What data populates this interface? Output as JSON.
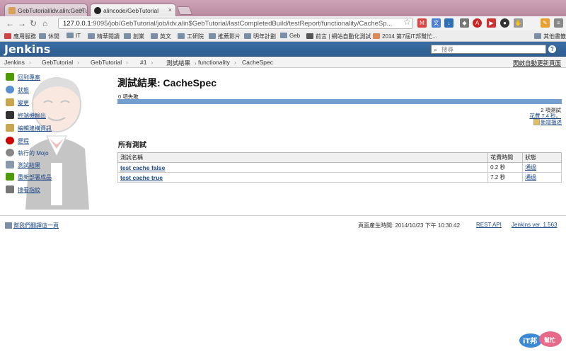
{
  "browser": {
    "tabs": [
      {
        "label": "GebTutorial/idv.alin:GebTu"
      },
      {
        "label": "alincode/GebTutorial"
      }
    ],
    "url_host": "127.0.0.1",
    "url_rest": ":9095/job/GebTutorial/job/idv.alin$GebTutorial/lastCompletedBuild/testReport/functionality/CacheSp...",
    "bookmarks": [
      "應用服務",
      "休閒",
      "IT",
      "精華閱讀",
      "創業",
      "英文",
      "工研院",
      "推薦影片",
      "明年計劃",
      "Geb",
      "前言 | 網站自動化測試",
      "2014 第7屆iT邦幫忙...",
      "其他書籤"
    ]
  },
  "jenkins": {
    "logo": "Jenkins",
    "search_placeholder": "搜尋",
    "help": "?",
    "breadcrumbs": [
      "Jenkins",
      "GebTutorial",
      "GebTutorial",
      "#1",
      "測試結果",
      "functionality",
      "CacheSpec"
    ],
    "auto_refresh": "開啟自動更新頁面"
  },
  "sidebar": {
    "items": [
      {
        "label": "回到專案",
        "icon": "up-arrow-icon",
        "color": "#4e9a06"
      },
      {
        "label": "狀態",
        "icon": "magnifier-icon",
        "color": "#5a8fd0"
      },
      {
        "label": "變更",
        "icon": "notepad-icon",
        "color": "#c9a550"
      },
      {
        "label": "終端機輸出",
        "icon": "terminal-icon",
        "color": "#333333"
      },
      {
        "label": "編輯建構資訊",
        "icon": "notepad-edit-icon",
        "color": "#c9a550"
      },
      {
        "label": "歷程",
        "icon": "delete-icon",
        "color": "#cc0000"
      },
      {
        "label": "執行的 Mojo",
        "icon": "gear-icon",
        "color": "#888888"
      },
      {
        "label": "測試結果",
        "icon": "clipboard-icon",
        "color": "#8899aa"
      },
      {
        "label": "重新部署成品",
        "icon": "redeploy-icon",
        "color": "#4e9a06"
      },
      {
        "label": "搜看指紋",
        "icon": "fingerprint-icon",
        "color": "#777777"
      }
    ]
  },
  "main": {
    "title": "測試結果: CacheSpec",
    "fail_count": "0 項失敗",
    "total_tests": "2 項測試",
    "duration": "花費 7.4 秒。",
    "edit_description": "新增描述",
    "section_title": "所有測試",
    "table": {
      "headers": [
        "測試名稱",
        "花費時間",
        "狀態"
      ],
      "rows": [
        {
          "name": "test cache false",
          "duration": "0.2 秒",
          "status": "通過"
        },
        {
          "name": "test cache true",
          "duration": "7.2 秒",
          "status": "通過"
        }
      ]
    }
  },
  "footer": {
    "help_translate": "幫我們翻譯這一頁",
    "generated": "頁面產生時間: 2014/10/23 下午 10:30:42",
    "rest_api": "REST API",
    "version": "Jenkins ver. 1.563"
  },
  "watermark": {
    "text1": "iT邦",
    "text2": "幫忙"
  },
  "colors": {
    "jenkins_header": "#2e5e91",
    "progress_bar": "#729fcf",
    "link": "#204a87"
  }
}
